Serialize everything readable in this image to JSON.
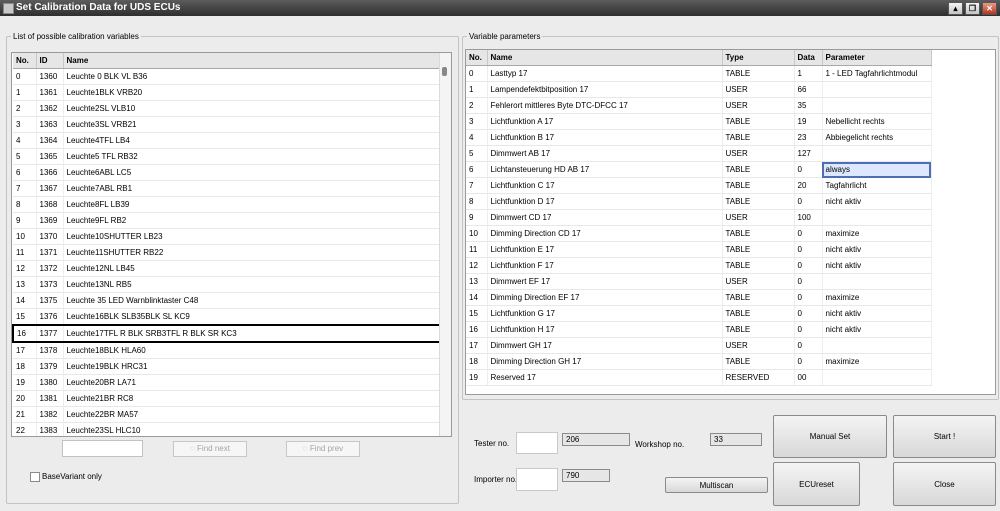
{
  "window": {
    "title": "Set Calibration Data for UDS ECUs"
  },
  "left": {
    "group_title": "List of possible calibration variables",
    "columns": [
      "No.",
      "ID",
      "Name"
    ],
    "rows": [
      [
        "0",
        "1360",
        "Leuchte 0 BLK VL B36"
      ],
      [
        "1",
        "1361",
        "Leuchte1BLK VRB20"
      ],
      [
        "2",
        "1362",
        "Leuchte2SL VLB10"
      ],
      [
        "3",
        "1363",
        "Leuchte3SL VRB21"
      ],
      [
        "4",
        "1364",
        "Leuchte4TFL LB4"
      ],
      [
        "5",
        "1365",
        "Leuchte5 TFL RB32"
      ],
      [
        "6",
        "1366",
        "Leuchte6ABL LC5"
      ],
      [
        "7",
        "1367",
        "Leuchte7ABL RB1"
      ],
      [
        "8",
        "1368",
        "Leuchte8FL LB39"
      ],
      [
        "9",
        "1369",
        "Leuchte9FL RB2"
      ],
      [
        "10",
        "1370",
        "Leuchte10SHUTTER LB23"
      ],
      [
        "11",
        "1371",
        "Leuchte11SHUTTER RB22"
      ],
      [
        "12",
        "1372",
        "Leuchte12NL LB45"
      ],
      [
        "13",
        "1373",
        "Leuchte13NL RB5"
      ],
      [
        "14",
        "1375",
        "Leuchte 35 LED Warnblinktaster C48"
      ],
      [
        "15",
        "1376",
        "Leuchte16BLK SLB35BLK SL KC9"
      ],
      [
        "16",
        "1377",
        "Leuchte17TFL R BLK SRB3TFL R BLK SR KC3"
      ],
      [
        "17",
        "1378",
        "Leuchte18BLK HLA60"
      ],
      [
        "18",
        "1379",
        "Leuchte19BLK HRC31"
      ],
      [
        "19",
        "1380",
        "Leuchte20BR LA71"
      ],
      [
        "20",
        "1381",
        "Leuchte21BR RC8"
      ],
      [
        "21",
        "1382",
        "Leuchte22BR MA57"
      ],
      [
        "22",
        "1383",
        "Leuchte23SL HLC10"
      ]
    ],
    "selected_row": 16,
    "search_placeholder": "",
    "find_next_label": "Find next",
    "find_prev_label": "Find prev",
    "basevariant_label": "BaseVariant only"
  },
  "right": {
    "group_title": "Variable parameters",
    "columns": [
      "No.",
      "Name",
      "Type",
      "Data",
      "Parameter"
    ],
    "rows": [
      [
        "0",
        "Lasttyp 17",
        "TABLE",
        "1",
        "1 - LED Tagfahrlichtmodul"
      ],
      [
        "1",
        "Lampendefektbitposition 17",
        "USER",
        "66",
        ""
      ],
      [
        "2",
        "Fehlerort mittleres Byte DTC-DFCC 17",
        "USER",
        "35",
        ""
      ],
      [
        "3",
        "Lichtfunktion A 17",
        "TABLE",
        "19",
        "Nebellicht rechts"
      ],
      [
        "4",
        "Lichtfunktion B 17",
        "TABLE",
        "23",
        "Abbiegelicht rechts"
      ],
      [
        "5",
        "Dimmwert AB 17",
        "USER",
        "127",
        ""
      ],
      [
        "6",
        "Lichtansteuerung HD AB 17",
        "TABLE",
        "0",
        "always"
      ],
      [
        "7",
        "Lichtfunktion C 17",
        "TABLE",
        "20",
        "Tagfahrlicht"
      ],
      [
        "8",
        "Lichtfunktion D 17",
        "TABLE",
        "0",
        "nicht aktiv"
      ],
      [
        "9",
        "Dimmwert CD 17",
        "USER",
        "100",
        ""
      ],
      [
        "10",
        "Dimming Direction CD 17",
        "TABLE",
        "0",
        "maximize"
      ],
      [
        "11",
        "Lichtfunktion E 17",
        "TABLE",
        "0",
        "nicht aktiv"
      ],
      [
        "12",
        "Lichtfunktion F 17",
        "TABLE",
        "0",
        "nicht aktiv"
      ],
      [
        "13",
        "Dimmwert EF 17",
        "USER",
        "0",
        ""
      ],
      [
        "14",
        "Dimming Direction EF 17",
        "TABLE",
        "0",
        "maximize"
      ],
      [
        "15",
        "Lichtfunktion G 17",
        "TABLE",
        "0",
        "nicht aktiv"
      ],
      [
        "16",
        "Lichtfunktion H 17",
        "TABLE",
        "0",
        "nicht aktiv"
      ],
      [
        "17",
        "Dimmwert GH 17",
        "USER",
        "0",
        ""
      ],
      [
        "18",
        "Dimming Direction GH 17",
        "TABLE",
        "0",
        "maximize"
      ],
      [
        "19",
        "Reserved 17",
        "RESERVED",
        "00",
        ""
      ]
    ],
    "highlighted_cell_row": 6
  },
  "bottom": {
    "tester_label": "Tester no.",
    "tester_value": "206",
    "workshop_label": "Workshop no.",
    "workshop_value": "33",
    "importer_label": "Importer no.",
    "importer_value": "790",
    "multiscan_label": "Multiscan",
    "manual_set_label": "Manual Set",
    "start_label": "Start !",
    "ecureset_label": "ECUreset",
    "close_label": "Close"
  }
}
